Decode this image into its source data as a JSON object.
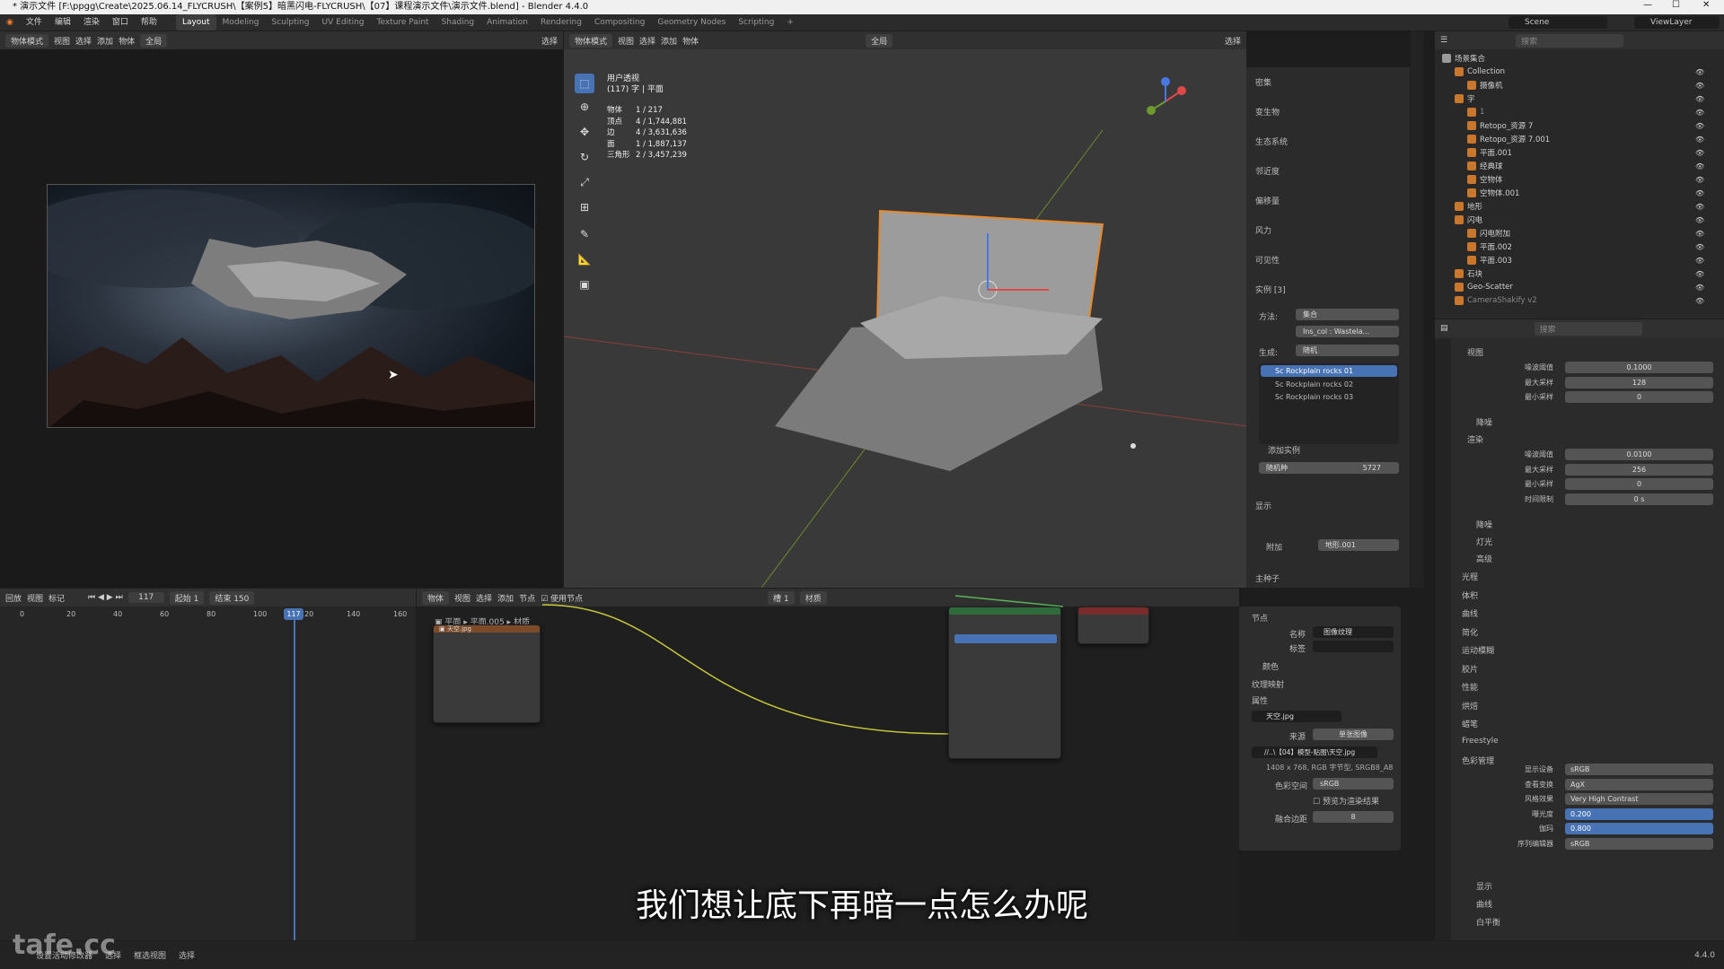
{
  "title_bar": {
    "text": "* 演示文件 [F:\\ppgg\\Create\\2025.06.14_FLYCRUSH\\【案例5】暗黑闪电-FLYCRUSH\\【07】课程演示文件\\演示文件.blend] - Blender 4.4.0"
  },
  "menu": [
    "文件",
    "编辑",
    "渲染",
    "窗口",
    "帮助"
  ],
  "workspaces": [
    "Layout",
    "Modeling",
    "Sculpting",
    "UV Editing",
    "Texture Paint",
    "Shading",
    "Animation",
    "Rendering",
    "Compositing",
    "Geometry Nodes",
    "Scripting"
  ],
  "topright": {
    "scene": "Scene",
    "viewlayer": "ViewLayer"
  },
  "image_editor": {
    "mode": "物体模式",
    "menus": [
      "视图",
      "选择",
      "添加",
      "物体"
    ],
    "global": "全局",
    "select_label": "选择"
  },
  "viewport": {
    "mode": "物体模式",
    "menus": [
      "视图",
      "选择",
      "添加",
      "物体"
    ],
    "global": "全局",
    "select_label": "选择",
    "overlay_title": "用户透视",
    "overlay_sub": "(117) 字 | 平面",
    "stats": [
      [
        "物体",
        "1 / 217"
      ],
      [
        "顶点",
        "4 / 1,744,881"
      ],
      [
        "边",
        "4 / 3,631,636"
      ],
      [
        "面",
        "1 / 1,887,137"
      ],
      [
        "三角形",
        "2 / 3,457,239"
      ]
    ]
  },
  "modifiers": {
    "sections": [
      "密集",
      "变生物",
      "生态系统",
      "邻近度",
      "偏移量",
      "风力",
      "可见性"
    ],
    "instances_title": "实例 [3]",
    "method_label": "方法:",
    "method_value": "集合",
    "collection_value": "Ins_col : Wastela...",
    "generate_label": "生成:",
    "generate_value": "随机",
    "list": [
      "Sc Rockplain rocks 01",
      "Sc Rockplain rocks 02",
      "Sc Rockplain rocks 03"
    ],
    "add_instance": "添加实例",
    "seed_label": "随机种",
    "seed_value": "5727",
    "display": "显示",
    "attach_label": "附加",
    "attach_value": "地形.001",
    "seed_bottom": "主种子"
  },
  "outliner": {
    "title": "场景集合",
    "search_placeholder": "搜索",
    "items": [
      {
        "name": "Collection",
        "indent": 1,
        "color": "#cfcfcf"
      },
      {
        "name": "摄像机",
        "indent": 2,
        "color": "#cfcfcf"
      },
      {
        "name": "字",
        "indent": 1,
        "color": "#cfcfcf"
      },
      {
        "name": "1",
        "indent": 2,
        "color": "#888"
      },
      {
        "name": "Retopo_资源 7",
        "indent": 2,
        "color": "#cfcfcf"
      },
      {
        "name": "Retopo_资源 7.001",
        "indent": 2,
        "color": "#cfcfcf"
      },
      {
        "name": "平面.001",
        "indent": 2,
        "color": "#cfcfcf"
      },
      {
        "name": "经典球",
        "indent": 2,
        "color": "#cfcfcf"
      },
      {
        "name": "空物体",
        "indent": 2,
        "color": "#cfcfcf"
      },
      {
        "name": "空物体.001",
        "indent": 2,
        "color": "#cfcfcf"
      },
      {
        "name": "地形",
        "indent": 1,
        "color": "#cfcfcf"
      },
      {
        "name": "闪电",
        "indent": 1,
        "color": "#cfcfcf"
      },
      {
        "name": "闪电附加",
        "indent": 2,
        "color": "#cfcfcf"
      },
      {
        "name": "平面.002",
        "indent": 2,
        "color": "#cfcfcf"
      },
      {
        "name": "平面.003",
        "indent": 2,
        "color": "#cfcfcf"
      },
      {
        "name": "石块",
        "indent": 1,
        "color": "#cfcfcf"
      },
      {
        "name": "Geo-Scatter",
        "indent": 1,
        "color": "#cfcfcf"
      },
      {
        "name": "CameraShakify v2",
        "indent": 1,
        "color": "#888"
      }
    ]
  },
  "properties": {
    "search_placeholder": "搜索",
    "viewport_section": "视图",
    "viewport_rows": [
      [
        "噪波阈值",
        "0.1000"
      ],
      [
        "最大采样",
        "128"
      ],
      [
        "最小采样",
        "0"
      ]
    ],
    "denoise": "降噪",
    "render_section": "渲染",
    "render_rows": [
      [
        "噪波阈值",
        "0.0100"
      ],
      [
        "最大采样",
        "256"
      ],
      [
        "最小采样",
        "0"
      ],
      [
        "时间限制",
        "0 s"
      ]
    ],
    "collapsed": [
      "降噪",
      "灯光",
      "高级"
    ],
    "groups": [
      "光程",
      "体积",
      "曲线",
      "简化",
      "运动模糊",
      "胶片",
      "性能",
      "烘焙",
      "蜡笔",
      "Freestyle",
      "色彩管理"
    ],
    "cm_rows": [
      [
        "显示设备",
        "sRGB"
      ],
      [
        "查看变换",
        "AgX"
      ],
      [
        "风格效果",
        "Very High Contrast"
      ],
      [
        "曝光度",
        "0.200"
      ],
      [
        "伽玛",
        "0.800"
      ],
      [
        "序列编辑器",
        "sRGB"
      ]
    ],
    "bottom": [
      "显示",
      "曲线",
      "白平衡"
    ]
  },
  "timeline": {
    "menus": [
      "回放",
      "视图",
      "标记"
    ],
    "frame": "117",
    "start_label": "起始",
    "start": "1",
    "end_label": "结束",
    "end": "150",
    "ticks": [
      "0",
      "20",
      "40",
      "60",
      "80",
      "100",
      "120",
      "140",
      "160"
    ]
  },
  "node_editor": {
    "menus": [
      "物体",
      "视图",
      "选择",
      "添加",
      "节点"
    ],
    "use_nodes": "使用节点",
    "slot": "槽 1",
    "material": "材质",
    "object": "平面",
    "material_name": "平面.005",
    "breadcrumb2": "材质"
  },
  "node_sidebar": {
    "node_section": "节点",
    "name_label": "名称",
    "name_value": "图像纹理",
    "label_label": "标签",
    "color": "颜色",
    "texture_mapping": "纹理映射",
    "props": "属性",
    "image": "天空.jpg",
    "source_label": "来源",
    "source_value": "单张图像",
    "filepath": "//..\\【04】模型-贴图\\天空.jpg",
    "info": "1408 x 768, RGB 字节型, SRGB8_A8",
    "colorspace_label": "色彩空间",
    "colorspace_value": "sRGB",
    "alpha_label": "预览为渲染结果",
    "offset_label": "融合边距",
    "offset_value": "8"
  },
  "status": {
    "items": [
      "设置活动修改器",
      "选择",
      "框选视图",
      "选择"
    ],
    "version": "4.4.0",
    "watermark": "tafe.cc"
  },
  "subtitle": "我们想让底下再暗一点怎么办呢"
}
